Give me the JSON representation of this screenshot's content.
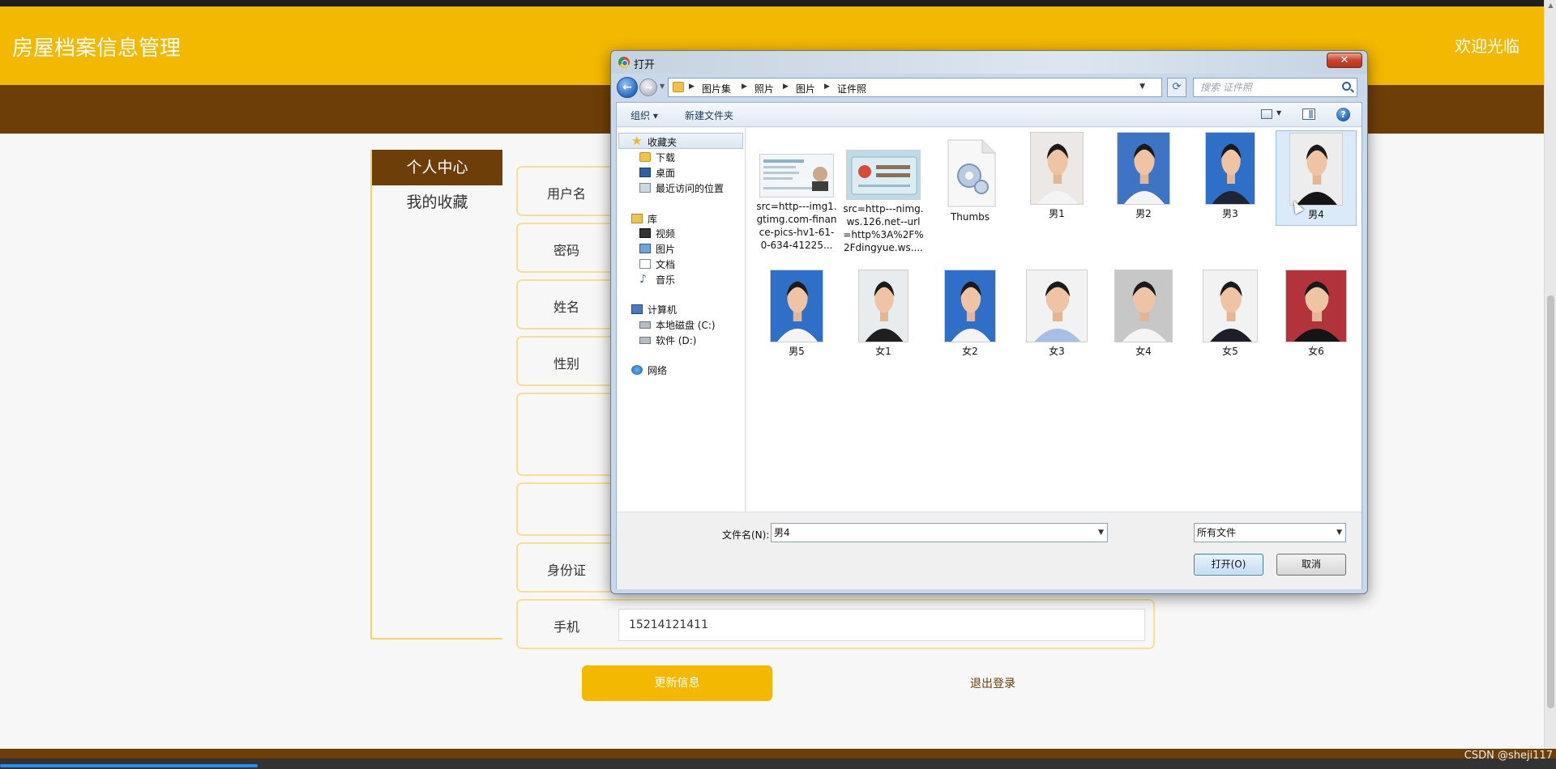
{
  "header": {
    "title": "房屋档案信息管理",
    "welcome": "欢迎光临"
  },
  "sidebar": {
    "heading": "个人中心",
    "items": [
      {
        "label": "我的收藏"
      }
    ]
  },
  "form": {
    "rows": [
      {
        "label": "用户名",
        "value": ""
      },
      {
        "label": "密码",
        "value": ""
      },
      {
        "label": "姓名",
        "value": ""
      },
      {
        "label": "性别",
        "value": ""
      },
      {
        "label": "",
        "value": ""
      },
      {
        "label": "",
        "value": ""
      },
      {
        "label": "身份证",
        "value": ""
      },
      {
        "label": "手机",
        "value": "15214121411"
      }
    ],
    "update_label": "更新信息",
    "logout_label": "退出登录"
  },
  "dialog": {
    "title": "打开",
    "breadcrumbs": [
      "图片集",
      "照片",
      "图片",
      "证件照"
    ],
    "search_placeholder": "搜索 证件照",
    "toolbar": {
      "organize": "组织 ▾",
      "new_folder": "新建文件夹"
    },
    "nav": {
      "favorites": "收藏夹",
      "downloads": "下载",
      "desktop": "桌面",
      "recent": "最近访问的位置",
      "libraries": "库",
      "videos": "视频",
      "pictures": "图片",
      "documents": "文档",
      "music": "音乐",
      "computer": "计算机",
      "drive_c": "本地磁盘 (C:)",
      "drive_d": "软件 (D:)",
      "network": "网络"
    },
    "files": [
      {
        "name": "src=http---img1.gtimg.com-finance-pics-hv1-61-0-634-41225...",
        "kind": "card1"
      },
      {
        "name": "src=http---nimg.ws.126.net--url=http%3A%2F%2Fdingyue.ws....",
        "kind": "card2"
      },
      {
        "name": "Thumbs",
        "kind": "thumbs"
      },
      {
        "name": "男1",
        "kind": "photo",
        "bg": "#ece8e6",
        "shirt": "#f4f4f4"
      },
      {
        "name": "男2",
        "kind": "photo",
        "bg": "#3d74c4",
        "shirt": "#f4f4f4"
      },
      {
        "name": "男3",
        "kind": "photo",
        "bg": "#2f6fc7",
        "shirt": "#1e2433"
      },
      {
        "name": "男4",
        "kind": "photo",
        "bg": "#ededed",
        "shirt": "#151515",
        "selected": true
      },
      {
        "name": "男5",
        "kind": "photo",
        "bg": "#2f6fc7",
        "shirt": "#f4f4f4"
      },
      {
        "name": "女1",
        "kind": "photo",
        "bg": "#e8ecef",
        "shirt": "#1f1f1f"
      },
      {
        "name": "女2",
        "kind": "photo",
        "bg": "#2f6fc7",
        "shirt": "#f4f4f4"
      },
      {
        "name": "女3",
        "kind": "photo",
        "bg": "#f2f2f2",
        "shirt": "#a8bfe4"
      },
      {
        "name": "女4",
        "kind": "photo",
        "bg": "#c7c7c7",
        "shirt": "#f4f4f4"
      },
      {
        "name": "女5",
        "kind": "photo",
        "bg": "#f2f2f2",
        "shirt": "#1e1e2a"
      },
      {
        "name": "女6",
        "kind": "photo",
        "bg": "#b3333c",
        "shirt": "#151515"
      }
    ],
    "filename_label": "文件名(N):",
    "filename_value": "男4",
    "filetype_value": "所有文件",
    "open_label": "打开(O)",
    "cancel_label": "取消"
  },
  "watermark": "CSDN @sheji117",
  "colors": {
    "accent": "#f3b800",
    "brown": "#6e3e08"
  }
}
